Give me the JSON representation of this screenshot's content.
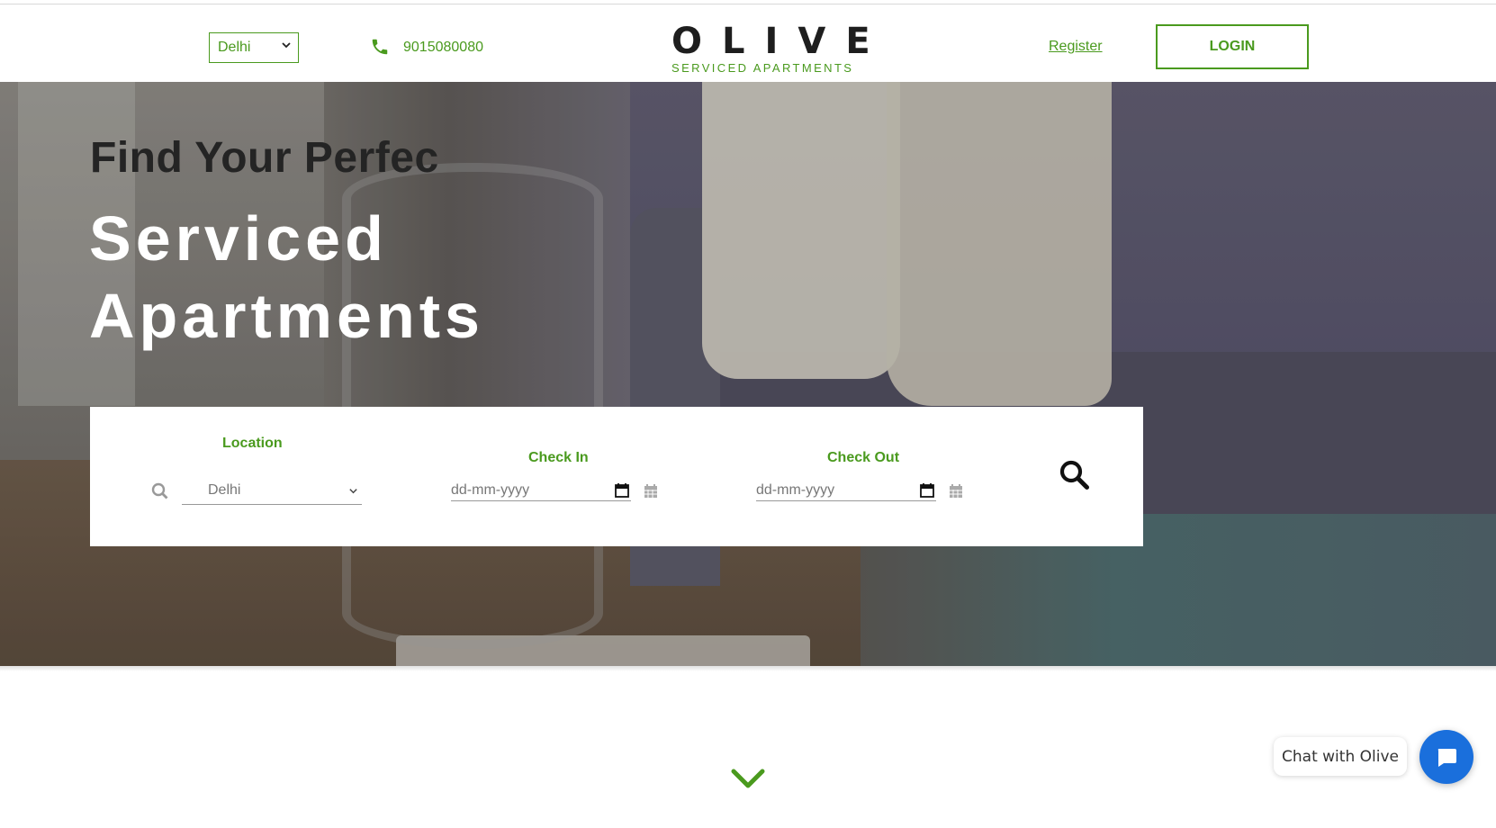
{
  "header": {
    "city_select": "Delhi",
    "phone": "9015080080",
    "logo_main": "OLIVE",
    "logo_sub": "SERVICED APARTMENTS",
    "register_label": "Register",
    "login_label": "LOGIN"
  },
  "hero": {
    "line1": "Find Your Perfec",
    "line2": "Serviced",
    "line3": "Apartments"
  },
  "search": {
    "location_label": "Location",
    "location_value": "Delhi",
    "checkin_label": "Check In",
    "checkin_placeholder": "dd-mm-yyyy",
    "checkout_label": "Check Out",
    "checkout_placeholder": "dd-mm-yyyy"
  },
  "chat": {
    "label": "Chat with Olive"
  },
  "colors": {
    "brand_green": "#4a9a1e",
    "chat_blue": "#1a6fdc"
  },
  "icons": [
    "chevron-down-icon",
    "phone-icon",
    "search-icon",
    "calendar-icon",
    "chat-bubble-icon"
  ]
}
